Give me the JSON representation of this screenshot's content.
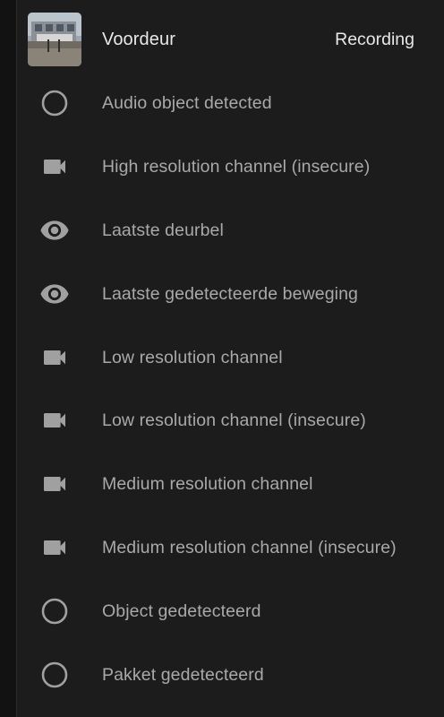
{
  "header": {
    "name": "Voordeur",
    "state": "Recording",
    "thumbnail_icon": "camera-snapshot-thumbnail"
  },
  "entities": [
    {
      "label": "Audio object detected",
      "icon": "circle-outline-icon"
    },
    {
      "label": "High resolution channel (insecure)",
      "icon": "video-camera-icon"
    },
    {
      "label": "Laatste deurbel",
      "icon": "eye-icon"
    },
    {
      "label": "Laatste gedetecteerde beweging",
      "icon": "eye-icon"
    },
    {
      "label": "Low resolution channel",
      "icon": "video-camera-icon"
    },
    {
      "label": "Low resolution channel (insecure)",
      "icon": "video-camera-icon"
    },
    {
      "label": "Medium resolution channel",
      "icon": "video-camera-icon"
    },
    {
      "label": "Medium resolution channel (insecure)",
      "icon": "video-camera-icon"
    },
    {
      "label": "Object gedetecteerd",
      "icon": "circle-outline-icon"
    },
    {
      "label": "Pakket gedetecteerd",
      "icon": "circle-outline-icon"
    }
  ],
  "colors": {
    "background": "#1c1c1c",
    "text_primary": "#e8e8e8",
    "text_secondary": "#a9a9a9",
    "icon": "#a0a0a0"
  }
}
